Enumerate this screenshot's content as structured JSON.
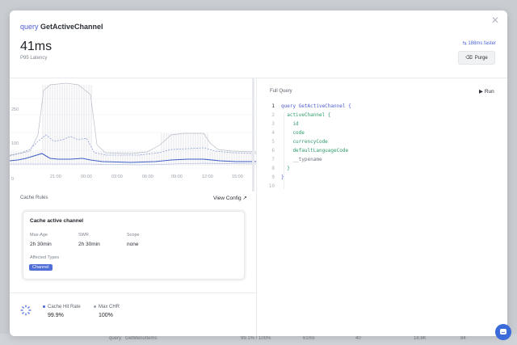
{
  "background_row": {
    "query_kw": "query",
    "query_name": "GetMenuItems",
    "hit": "99.1% / 100%",
    "latency": "61ms",
    "requests": "40",
    "size": "18.8K",
    "count": "84"
  },
  "modal": {
    "title_keyword": "query",
    "title_name": "GetActiveChannel",
    "latency_value": "41ms",
    "latency_label": "P95 Latency",
    "faster_text": "188ms faster",
    "purge_label": "Purge"
  },
  "chart_data": {
    "type": "line",
    "x_ticks": [
      "21:00",
      "00:00",
      "03:00",
      "06:00",
      "09:00",
      "12:00",
      "15:00"
    ],
    "y_ticks": [
      "250",
      "100",
      "0"
    ],
    "grid": true,
    "legend": "none"
  },
  "cache_rules": {
    "label": "Cache Rules",
    "view_config": "View Config",
    "card": {
      "title": "Cache active channel",
      "max_age_label": "Max-Age",
      "max_age_value": "2h 30min",
      "swr_label": "SWR",
      "swr_value": "2h 30min",
      "scope_label": "Scope",
      "scope_value": "none",
      "affected_label": "Affected Types",
      "affected_badge": "Channel"
    }
  },
  "stats": {
    "hit_rate_label": "Cache Hit Rate",
    "hit_rate_value": "99.9%",
    "max_chr_label": "Max CHR",
    "max_chr_value": "100%",
    "hit_rate_color": "#4a63d8",
    "max_chr_color": "#9aa3ad"
  },
  "query": {
    "label": "Full Query",
    "run_label": "Run",
    "lines": [
      {
        "n": "1",
        "kw": "query",
        "text": " GetActiveChannel {"
      },
      {
        "n": "2",
        "kw": "",
        "text": "  activeChannel {"
      },
      {
        "n": "3",
        "kw": "",
        "text": "    id"
      },
      {
        "n": "4",
        "kw": "",
        "text": "    code"
      },
      {
        "n": "5",
        "kw": "",
        "text": "    currencyCode"
      },
      {
        "n": "6",
        "kw": "",
        "text": "    defaultLanguageCode"
      },
      {
        "n": "7",
        "kw": "",
        "text": "    __typename"
      },
      {
        "n": "8",
        "kw": "",
        "text": "  }"
      },
      {
        "n": "9",
        "kw": "",
        "text": "}"
      },
      {
        "n": "10",
        "kw": "",
        "text": ""
      }
    ]
  },
  "colors": {
    "accent": "#4a63d8",
    "badge": "#4f6fd6",
    "chat": "#3b6bd9"
  }
}
